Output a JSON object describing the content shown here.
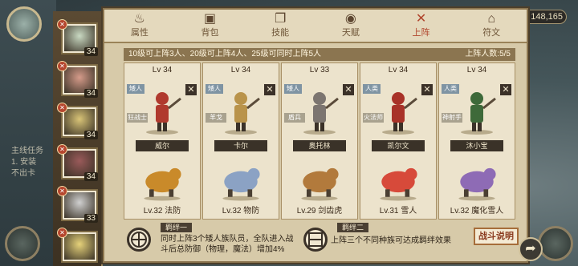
{
  "resource": "148,165",
  "left_text": "主线任务\n1. 安装\n不出卡",
  "tabs": [
    {
      "label": "属性",
      "icon": "flame-icon",
      "glyph": "♨"
    },
    {
      "label": "背包",
      "icon": "backpack-icon",
      "glyph": "▣"
    },
    {
      "label": "技能",
      "icon": "book-icon",
      "glyph": "❐"
    },
    {
      "label": "天赋",
      "icon": "eye-icon",
      "glyph": "◉"
    },
    {
      "label": "上阵",
      "icon": "crossed-swords-icon",
      "glyph": "✕"
    },
    {
      "label": "符文",
      "icon": "house-icon",
      "glyph": "⌂"
    }
  ],
  "active_tab": "上阵",
  "rule_text": "10级可上阵3人、20级可上阵4人、25级可同时上阵5人",
  "deploy_count": "上阵人数:5/5",
  "heroes_sidebar": [
    {
      "level": "34",
      "color": "#c9d9c2"
    },
    {
      "level": "34",
      "color": "#d59b8a"
    },
    {
      "level": "34",
      "color": "#d9c477"
    },
    {
      "level": "34",
      "color": "#9a5a5a"
    },
    {
      "level": "33",
      "color": "#d0d0d0"
    },
    {
      "level": "",
      "color": "#e6d27a"
    }
  ],
  "cards": [
    {
      "level": "Lv 34",
      "tag1": "矮人",
      "tag2": "狂战士",
      "name": "威尔",
      "mount": "Lv.32 法防",
      "fig_color": "#b03a2e",
      "mount_color": "#c98a2a"
    },
    {
      "level": "Lv 34",
      "tag1": "矮人",
      "tag2": "羊戈",
      "name": "卡尔",
      "mount": "Lv.32 物防",
      "fig_color": "#b9934a",
      "mount_color": "#8ba2c4"
    },
    {
      "level": "Lv 33",
      "tag1": "矮人",
      "tag2": "盾兵",
      "name": "奥托林",
      "mount": "Lv.29 剑齿虎",
      "fig_color": "#7c7570",
      "mount_color": "#b27a3c"
    },
    {
      "level": "Lv 34",
      "tag1": "人类",
      "tag2": "火法师",
      "name": "凯尔文",
      "mount": "Lv.31 雪人",
      "fig_color": "#a83228",
      "mount_color": "#d74a3a"
    },
    {
      "level": "Lv 34",
      "tag1": "人类",
      "tag2": "神射手",
      "name": "沐小宝",
      "mount": "Lv.32 魔化雪人",
      "fig_color": "#3e6a3a",
      "mount_color": "#8e6bb5"
    }
  ],
  "bond1": {
    "title": "羁绊一",
    "desc": "同时上阵3个矮人族队员，全队进入战斗后总防御（物理，魔法）增加4%"
  },
  "bond2": {
    "title": "羁绊二",
    "desc": "上阵三个不同种族可达成羁绊效果"
  },
  "explain_button": "战斗说明"
}
